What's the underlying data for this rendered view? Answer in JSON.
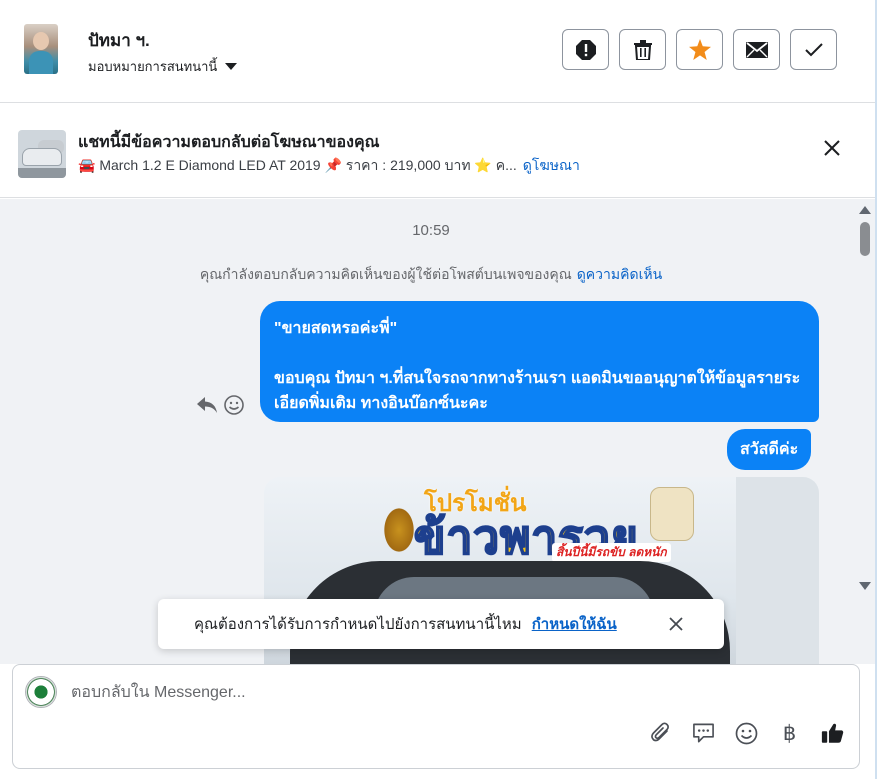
{
  "header": {
    "user_name": "ปัทมา ฯ.",
    "assign_label": "มอบหมายการสนทนานี้",
    "actions": [
      {
        "name": "report-button",
        "icon": "exclamation-octagon-icon"
      },
      {
        "name": "delete-button",
        "icon": "trash-icon"
      },
      {
        "name": "star-button",
        "icon": "star-icon"
      },
      {
        "name": "mark-unread-button",
        "icon": "envelope-icon"
      },
      {
        "name": "done-button",
        "icon": "check-icon"
      }
    ]
  },
  "ad": {
    "title": "แชทนี้มีข้อความตอบกลับต่อโฆษณาของคุณ",
    "subtitle": "🚘 March 1.2 E Diamond LED AT 2019 📌 ราคา : 219,000 บาท ⭐ ค...",
    "link": "ดูโฆษณา"
  },
  "conversation": {
    "time": "10:59",
    "notice": "คุณกำลังตอบกลับความคิดเห็นของผู้ใช้ต่อโพสต์บนเพจของคุณ",
    "notice_link": "ดูความคิดเห็น",
    "messages": [
      {
        "quote": "\"ขายสดหรอค่ะพี่\"",
        "text": "ขอบคุณ ปัทมา ฯ.ที่สนใจรถจากทางร้านเรา แอดมินขออนุญาตให้ข้อมูลรายระเอียดพิ่มเติม ทางอินบ๊อกซ์นะคะ"
      },
      {
        "text": "สวัสดีค่ะ"
      }
    ],
    "image_texts": {
      "top": "โปรโมชั่น",
      "main": "ข้าวพารวย",
      "sub": "สิ้นปีนี้มีรถขับ ลดหนัก"
    }
  },
  "toast": {
    "text": "คุณต้องการได้รับการกำหนดไปยังการสนทนานี้ไหม",
    "link": "กำหนดให้ฉัน"
  },
  "composer": {
    "placeholder": "ตอบกลับใน Messenger...",
    "tools": [
      "paperclip-icon",
      "saved-reply-icon",
      "emoji-icon",
      "baht-icon",
      "thumbs-up-icon"
    ]
  },
  "colors": {
    "bubble": "#0b82f6",
    "link": "#0a63c8",
    "star": "#f28c1a",
    "conversation_bg": "#f0f2f5"
  }
}
